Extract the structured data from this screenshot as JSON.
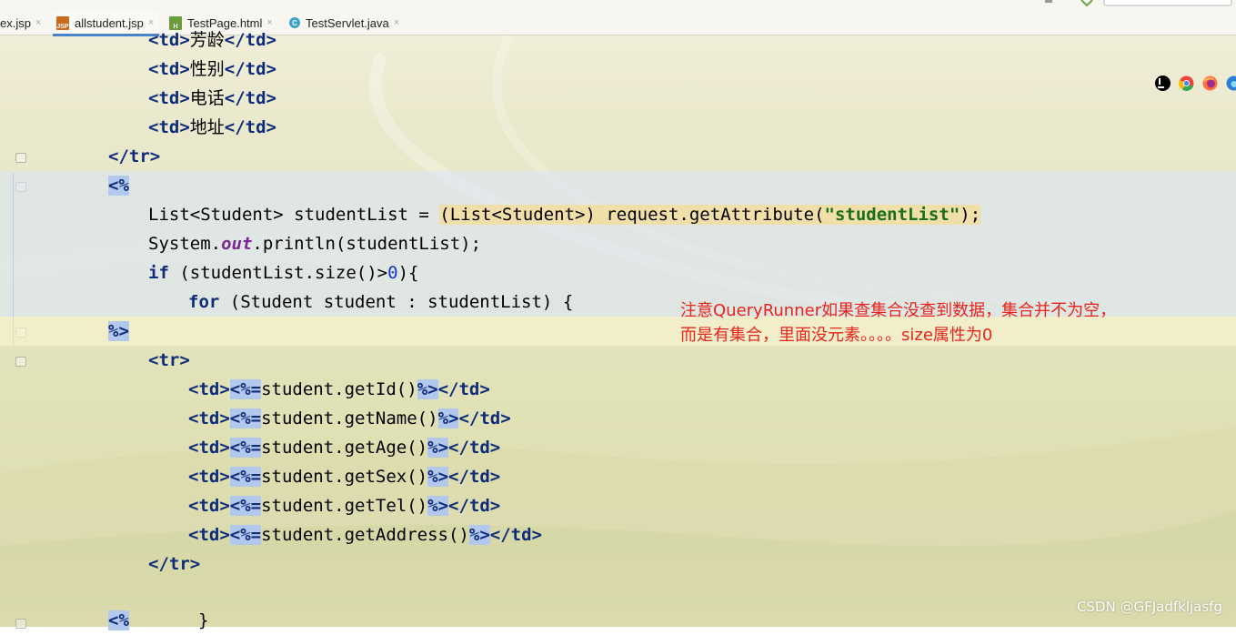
{
  "tabs": [
    {
      "label": "ex.jsp",
      "icon": "none"
    },
    {
      "label": "allstudent.jsp",
      "icon": "jsp-file-icon",
      "active": true
    },
    {
      "label": "TestPage.html",
      "icon": "html-file-icon"
    },
    {
      "label": "TestServlet.java",
      "icon": "java-class-icon"
    }
  ],
  "close_glyph": "×",
  "file_icons": {
    "jsp": "JSP",
    "html": "H",
    "java": "C"
  },
  "code": {
    "l1_open": "<td>",
    "l1_text": "芳龄",
    "l1_close": "</td>",
    "l2_open": "<td>",
    "l2_text": "性别",
    "l2_close": "</td>",
    "l3_open": "<td>",
    "l3_text": "电话",
    "l3_close": "</td>",
    "l4_open": "<td>",
    "l4_text": "地址",
    "l4_close": "</td>",
    "l5_close_tr": "</tr>",
    "l6_jsp_open": "<%",
    "l7_a": "List<Student> studentList = ",
    "l7_b": "(List<Student>) request.getAttribute(",
    "l7_str": "\"studentList\"",
    "l7_c": ");",
    "l8_a": "System.",
    "l8_field": "out",
    "l8_b": ".println(studentList);",
    "l9_kw": "if",
    "l9_a": " (studentList.size()>",
    "l9_num": "0",
    "l9_b": "){",
    "l10_kw": "for",
    "l10_a": " (Student student : studentList) {",
    "l11_jsp_close": "%>",
    "l12_tr": "<tr>",
    "td_open": "<td>",
    "expr_open": "<%=",
    "expr_close": "%>",
    "td_close": "</td>",
    "m1": "student.getId()",
    "m2": "student.getName()",
    "m3": "student.getAge()",
    "m4": "student.getSex()",
    "m5": "student.getTel()",
    "m6": "student.getAddress()",
    "l19_close_tr": "</tr>",
    "l21_jsp_open": "<%",
    "l21_brace": "}"
  },
  "annotation": {
    "line1": "注意QueryRunner如果查集合没查到数据，集合并不为空，",
    "line2": "而是有集合，里面没元素。。。。size属性为0"
  },
  "browser_icons": [
    "intellij-icon",
    "chrome-icon",
    "firefox-icon",
    "edge-icon"
  ],
  "watermark": "CSDN @GFJadfkljasfg",
  "colors": {
    "annotation": "#e8241c",
    "tag": "#0f2c7a",
    "string": "#1a6e1e",
    "field": "#7a2a93",
    "number": "#1733d3",
    "jsp_delimiter_bg": "#b2c8ec"
  }
}
